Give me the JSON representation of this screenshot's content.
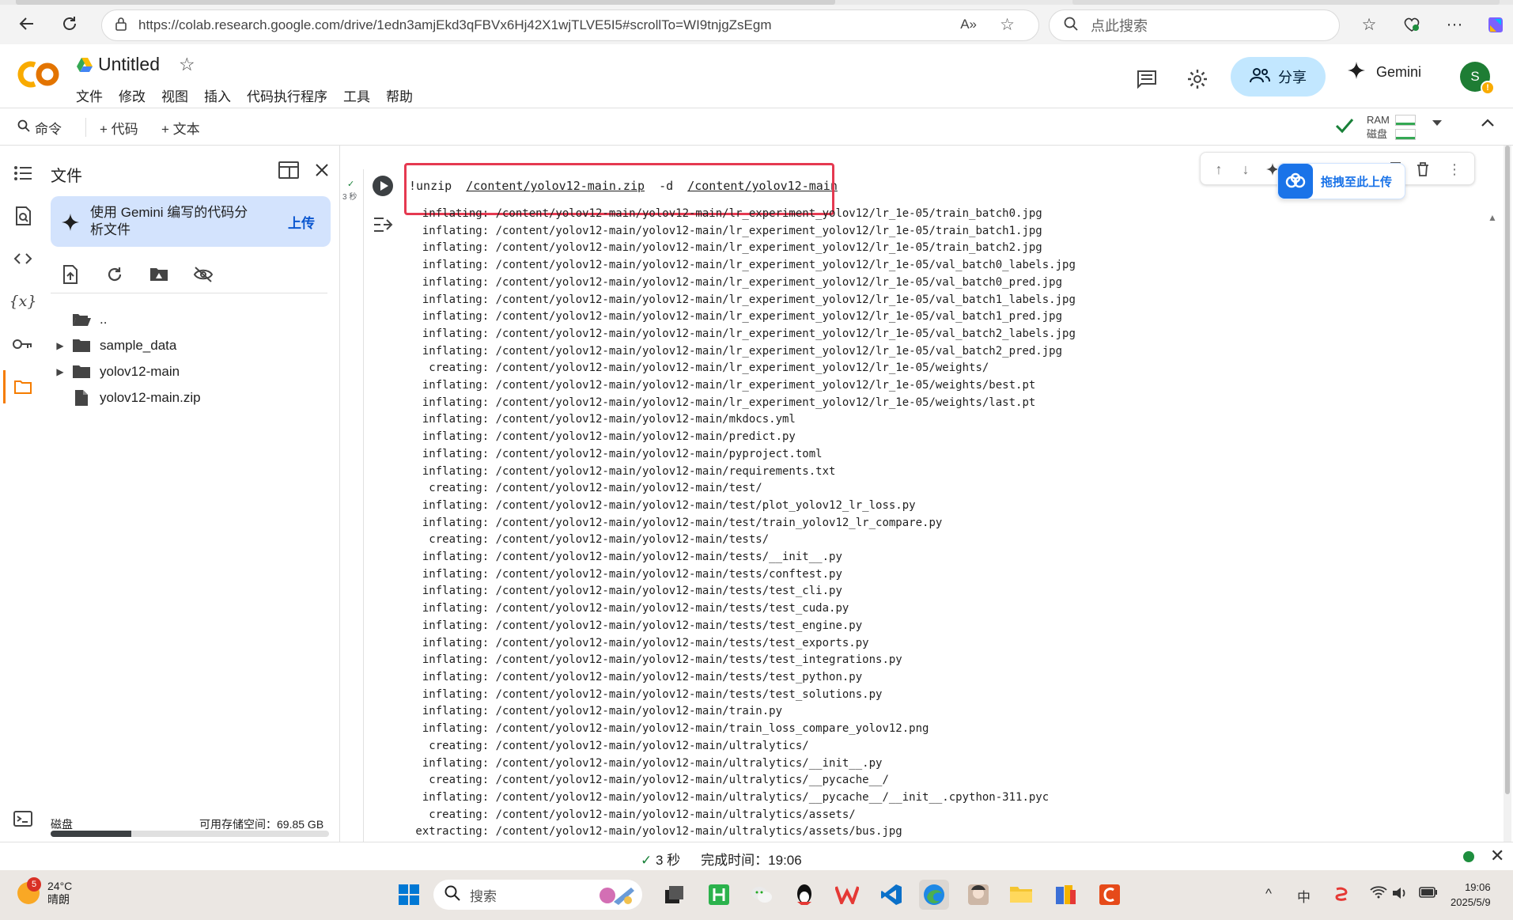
{
  "browser": {
    "url": "https://colab.research.google.com/drive/1edn3amjEkd3qFBVx6Hj42X1wjTLVE5I5#scrollTo=WI9tnjgZsEgm",
    "search_placeholder": "点此搜索"
  },
  "colab": {
    "title": "Untitled",
    "menu": [
      "文件",
      "修改",
      "视图",
      "插入",
      "代码执行程序",
      "工具",
      "帮助"
    ],
    "share_label": "分享",
    "gemini_label": "Gemini",
    "avatar_letter": "S",
    "avatar_badge": "!"
  },
  "toolbar": {
    "command_label": "命令",
    "add_code_label": "+ 代码",
    "add_text_label": "+ 文本",
    "ram_label": "RAM",
    "disk_label": "磁盘"
  },
  "file_panel": {
    "title": "文件",
    "gemini_card_text": "使用 Gemini 编写的代码分析文件",
    "upload_label": "上传",
    "tree": [
      {
        "name": "..",
        "type": "folder-open",
        "expandable": false
      },
      {
        "name": "sample_data",
        "type": "folder",
        "expandable": true
      },
      {
        "name": "yolov12-main",
        "type": "folder",
        "expandable": true
      },
      {
        "name": "yolov12-main.zip",
        "type": "file",
        "expandable": false
      }
    ],
    "disk_label": "磁盘",
    "disk_free": "可用存储空间：69.85 GB",
    "disk_used_fraction": 0.29
  },
  "cell": {
    "exec_time": "3 秒",
    "command_prefix": "!unzip",
    "command_arg1": "/content/yolov12-main.zip",
    "command_flag": "-d",
    "command_arg2": "/content/yolov12-main",
    "upload_popup": "拖拽至此上传",
    "output_lines": [
      "  inflating: /content/yolov12-main/yolov12-main/lr_experiment_yolov12/lr_1e-05/train_batch0.jpg",
      "  inflating: /content/yolov12-main/yolov12-main/lr_experiment_yolov12/lr_1e-05/train_batch1.jpg",
      "  inflating: /content/yolov12-main/yolov12-main/lr_experiment_yolov12/lr_1e-05/train_batch2.jpg",
      "  inflating: /content/yolov12-main/yolov12-main/lr_experiment_yolov12/lr_1e-05/val_batch0_labels.jpg",
      "  inflating: /content/yolov12-main/yolov12-main/lr_experiment_yolov12/lr_1e-05/val_batch0_pred.jpg",
      "  inflating: /content/yolov12-main/yolov12-main/lr_experiment_yolov12/lr_1e-05/val_batch1_labels.jpg",
      "  inflating: /content/yolov12-main/yolov12-main/lr_experiment_yolov12/lr_1e-05/val_batch1_pred.jpg",
      "  inflating: /content/yolov12-main/yolov12-main/lr_experiment_yolov12/lr_1e-05/val_batch2_labels.jpg",
      "  inflating: /content/yolov12-main/yolov12-main/lr_experiment_yolov12/lr_1e-05/val_batch2_pred.jpg",
      "   creating: /content/yolov12-main/yolov12-main/lr_experiment_yolov12/lr_1e-05/weights/",
      "  inflating: /content/yolov12-main/yolov12-main/lr_experiment_yolov12/lr_1e-05/weights/best.pt",
      "  inflating: /content/yolov12-main/yolov12-main/lr_experiment_yolov12/lr_1e-05/weights/last.pt",
      "  inflating: /content/yolov12-main/yolov12-main/mkdocs.yml",
      "  inflating: /content/yolov12-main/yolov12-main/predict.py",
      "  inflating: /content/yolov12-main/yolov12-main/pyproject.toml",
      "  inflating: /content/yolov12-main/yolov12-main/requirements.txt",
      "   creating: /content/yolov12-main/yolov12-main/test/",
      "  inflating: /content/yolov12-main/yolov12-main/test/plot_yolov12_lr_loss.py",
      "  inflating: /content/yolov12-main/yolov12-main/test/train_yolov12_lr_compare.py",
      "   creating: /content/yolov12-main/yolov12-main/tests/",
      "  inflating: /content/yolov12-main/yolov12-main/tests/__init__.py",
      "  inflating: /content/yolov12-main/yolov12-main/tests/conftest.py",
      "  inflating: /content/yolov12-main/yolov12-main/tests/test_cli.py",
      "  inflating: /content/yolov12-main/yolov12-main/tests/test_cuda.py",
      "  inflating: /content/yolov12-main/yolov12-main/tests/test_engine.py",
      "  inflating: /content/yolov12-main/yolov12-main/tests/test_exports.py",
      "  inflating: /content/yolov12-main/yolov12-main/tests/test_integrations.py",
      "  inflating: /content/yolov12-main/yolov12-main/tests/test_python.py",
      "  inflating: /content/yolov12-main/yolov12-main/tests/test_solutions.py",
      "  inflating: /content/yolov12-main/yolov12-main/train.py",
      "  inflating: /content/yolov12-main/yolov12-main/train_loss_compare_yolov12.png",
      "   creating: /content/yolov12-main/yolov12-main/ultralytics/",
      "  inflating: /content/yolov12-main/yolov12-main/ultralytics/__init__.py",
      "   creating: /content/yolov12-main/yolov12-main/ultralytics/__pycache__/",
      "  inflating: /content/yolov12-main/yolov12-main/ultralytics/__pycache__/__init__.cpython-311.pyc",
      "   creating: /content/yolov12-main/yolov12-main/ultralytics/assets/",
      " extracting: /content/yolov12-main/yolov12-main/ultralytics/assets/bus.jpg"
    ]
  },
  "status": {
    "check": "✓",
    "duration": "3 秒",
    "completed": "完成时间：19:06"
  },
  "taskbar": {
    "weather_badge": "5",
    "temperature": "24°C",
    "condition": "晴朗",
    "search_placeholder": "搜索",
    "ime": "中",
    "time": "19:06",
    "date": "2025/5/9"
  },
  "colors": {
    "accent": "#f57c00",
    "share_bg": "#c2e7ff",
    "highlight_box": "#e53950",
    "success": "#188038"
  }
}
